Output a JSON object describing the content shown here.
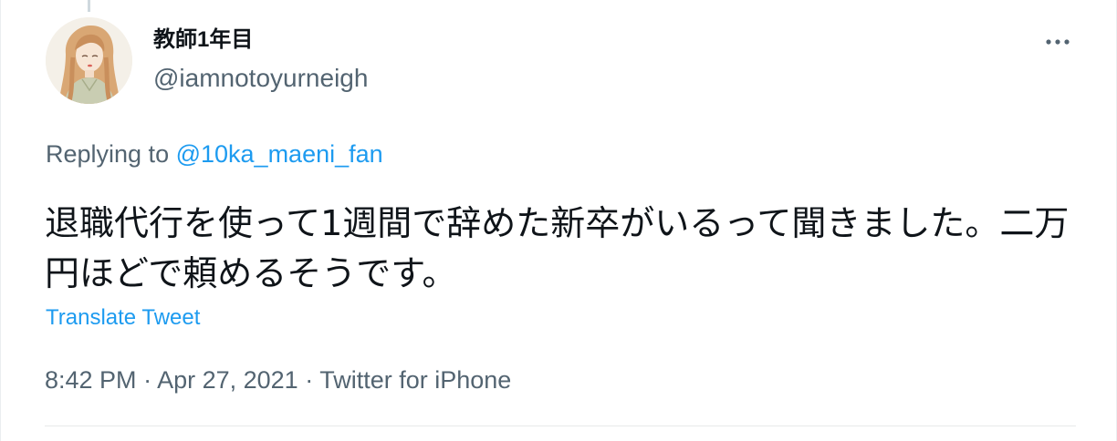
{
  "tweet": {
    "author": {
      "display_name": "教師1年目",
      "handle": "@iamnotoyurneigh",
      "avatar_icon": "avatar-illustration"
    },
    "more_icon": "more-horizontal-icon",
    "replying": {
      "prefix": "Replying to ",
      "mention": "@10ka_maeni_fan"
    },
    "text": "退職代行を使って1週間で辞めた新卒がいるって聞きました。二万円ほどで頼めるそうです。",
    "translate_label": "Translate Tweet",
    "meta": {
      "time": "8:42 PM",
      "separator": " · ",
      "date": "Apr 27, 2021",
      "source": "Twitter for iPhone"
    }
  },
  "colors": {
    "primary_text": "#0f1419",
    "secondary_text": "#536471",
    "link": "#1d9bf0",
    "divider": "#e7e9ea"
  }
}
